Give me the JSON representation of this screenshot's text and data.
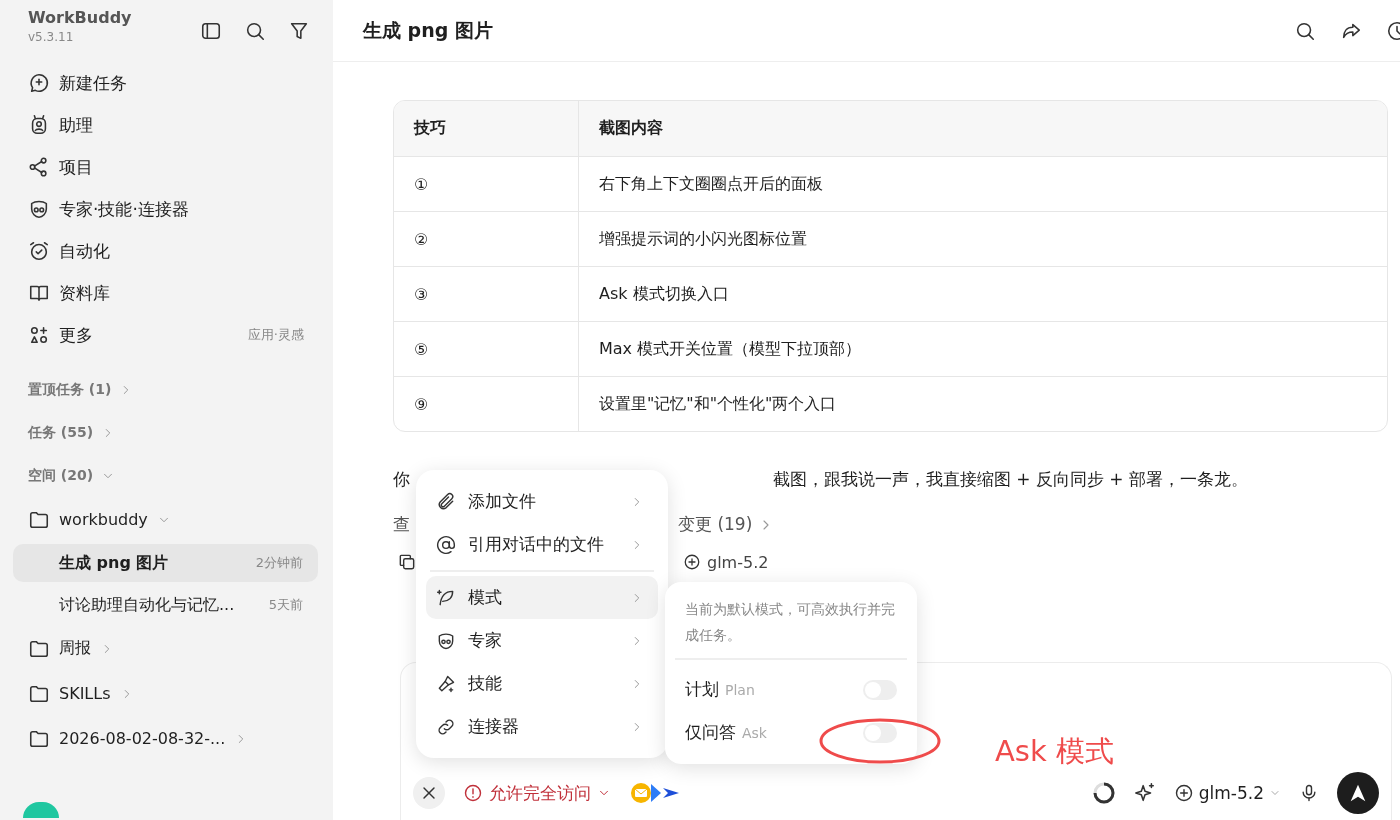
{
  "sidebar": {
    "app_name": "WorkBuddy",
    "version": "v5.3.11",
    "nav": [
      {
        "label": "新建任务"
      },
      {
        "label": "助理"
      },
      {
        "label": "项目"
      },
      {
        "label": "专家·技能·连接器"
      },
      {
        "label": "自动化"
      },
      {
        "label": "资料库"
      },
      {
        "label": "更多",
        "hint": "应用·灵感"
      }
    ],
    "sections": [
      {
        "label": "置顶任务 (1)",
        "expanded": false
      },
      {
        "label": "任务 (55)",
        "expanded": false
      },
      {
        "label": "空间 (20)",
        "expanded": true
      }
    ],
    "folders": [
      {
        "name": "workbuddy",
        "expanded": true,
        "children": [
          {
            "title": "生成 png 图片",
            "time": "2分钟前",
            "selected": true
          },
          {
            "title": "讨论助理自动化与记忆...",
            "time": "5天前",
            "selected": false
          }
        ]
      },
      {
        "name": "周报",
        "expanded": false
      },
      {
        "name": "SKILLs",
        "expanded": false
      },
      {
        "name": "2026-08-02-08-32-...",
        "expanded": false
      }
    ]
  },
  "main": {
    "title": "生成 png 图片",
    "table": {
      "columns": [
        "技巧",
        "截图内容"
      ],
      "rows": [
        [
          "①",
          "右下角上下文圈圈点开后的面板"
        ],
        [
          "②",
          "增强提示词的小闪光图标位置"
        ],
        [
          "③",
          "Ask 模式切换入口"
        ],
        [
          "⑤",
          "Max 模式开关位置（模型下拉顶部）"
        ],
        [
          "⑨",
          "设置里\"记忆\"和\"个性化\"两个入口"
        ]
      ]
    },
    "message_start": "你",
    "message_end": "截图，跟我说一声，我直接缩图 + 反向同步 + 部署，一条龙。",
    "link_start": "查",
    "link_end": "变更 (19)",
    "reply_model": "glm-5.2"
  },
  "composer": {
    "permission": "允许完全访问",
    "model": "glm-5.2"
  },
  "menu": [
    {
      "label": "添加文件",
      "selected": false
    },
    {
      "label": "引用对话中的文件",
      "selected": false
    },
    {
      "label": "模式",
      "selected": true
    },
    {
      "label": "专家",
      "selected": false
    },
    {
      "label": "技能",
      "selected": false
    },
    {
      "label": "连接器",
      "selected": false
    }
  ],
  "submenu": {
    "description": "当前为默认模式，可高效执行并完成任务。",
    "options": [
      {
        "label": "计划",
        "hint": "Plan",
        "on": false
      },
      {
        "label": "仅问答",
        "hint": "Ask",
        "on": false
      }
    ]
  },
  "annotation": {
    "label": "Ask 模式"
  }
}
